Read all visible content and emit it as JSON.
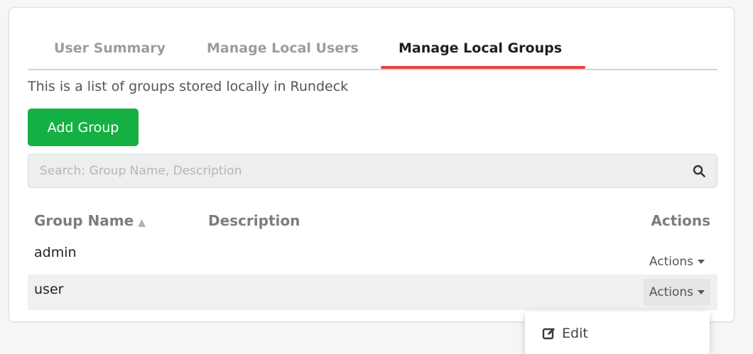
{
  "tabs": [
    {
      "label": "User Summary",
      "active": false
    },
    {
      "label": "Manage Local Users",
      "active": false
    },
    {
      "label": "Manage Local Groups",
      "active": true
    }
  ],
  "intro_text": "This is a list of groups stored locally in Rundeck",
  "add_button_label": "Add Group",
  "search": {
    "placeholder": "Search: Group Name, Description",
    "value": ""
  },
  "table": {
    "headers": {
      "name": "Group Name",
      "description": "Description",
      "actions": "Actions"
    },
    "sort_indicator": "▲",
    "rows": [
      {
        "name": "admin",
        "description": "",
        "actions_label": "Actions"
      },
      {
        "name": "user",
        "description": "",
        "actions_label": "Actions"
      }
    ]
  },
  "dropdown": {
    "items": [
      {
        "label": "Edit",
        "icon": "edit-icon"
      }
    ]
  },
  "colors": {
    "accent": "#ea3f3f",
    "primary_button": "#14b043",
    "active_tab": "#1e1e1e",
    "inactive_tab": "#9c9c9c"
  }
}
